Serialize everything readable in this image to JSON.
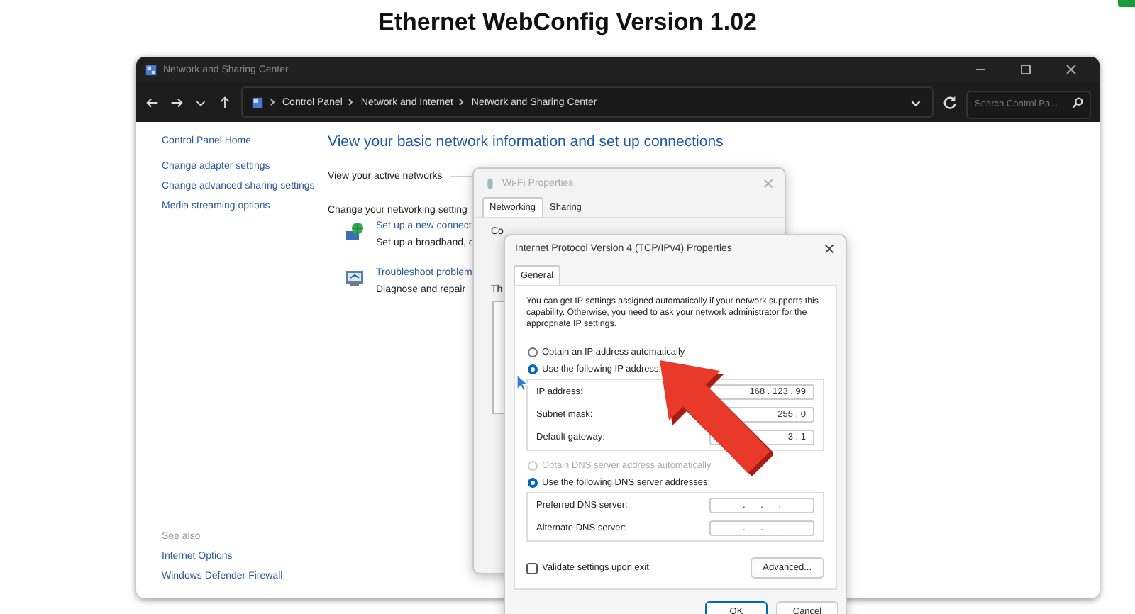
{
  "page_title": "Ethernet WebConfig Version 1.02",
  "window": {
    "title": "Network and Sharing Center",
    "breadcrumb": [
      "Control Panel",
      "Network and Internet",
      "Network and Sharing Center"
    ],
    "search": {
      "placeholder": "Search Control Pa..."
    },
    "sidebar": {
      "links": [
        "Control Panel Home",
        "Change adapter settings",
        "Change advanced sharing settings",
        "Media streaming options"
      ],
      "see_also_heading": "See also",
      "see_also": [
        "Internet Options",
        "Windows Defender Firewall"
      ]
    },
    "heading": "View your basic network information and set up connections",
    "active_networks_label": "View your active networks",
    "settings_label": "Change your networking setting",
    "tasks": [
      {
        "kind": "connection",
        "link": "Set up a new connecti",
        "description": "Set up a broadband, c"
      },
      {
        "kind": "troubleshoot",
        "link": "Troubleshoot problem",
        "description": "Diagnose and repair"
      }
    ]
  },
  "wifi_dialog": {
    "title": "Wi-Fi Properties",
    "tabs": [
      {
        "label": "Networking",
        "selected": true
      },
      {
        "label": "Sharing",
        "selected": false
      }
    ],
    "fragments": [
      "Co",
      "Th"
    ]
  },
  "ipv4_dialog": {
    "title": "Internet Protocol Version 4 (TCP/IPv4) Properties",
    "tabs": [
      {
        "label": "General",
        "selected": true
      }
    ],
    "description": "You can get IP settings assigned automatically if your network supports this capability. Otherwise, you need to ask your network administrator for the appropriate IP settings.",
    "ip_mode": [
      {
        "label": "Obtain an IP address automatically",
        "selected": false,
        "disabled": false
      },
      {
        "label": "Use the following IP address:",
        "selected": true,
        "disabled": false
      }
    ],
    "ip_fields": [
      {
        "label": "IP address:",
        "value": "168 . 123 . 99"
      },
      {
        "label": "Subnet mask:",
        "value": "255 . 0"
      },
      {
        "label": "Default gateway:",
        "value": "3 . 1"
      }
    ],
    "dns_mode": [
      {
        "label": "Obtain DNS server address automatically",
        "selected": false,
        "disabled": true
      },
      {
        "label": "Use the following DNS server addresses:",
        "selected": true,
        "disabled": false
      }
    ],
    "dns_fields": [
      {
        "label": "Preferred DNS server:",
        "value": ". . ."
      },
      {
        "label": "Alternate DNS server:",
        "value": ". . ."
      }
    ],
    "validate": {
      "label": "Validate settings upon exit",
      "checked": false
    },
    "advanced_button": "Advanced...",
    "buttons": [
      "OK",
      "Cancel"
    ]
  }
}
